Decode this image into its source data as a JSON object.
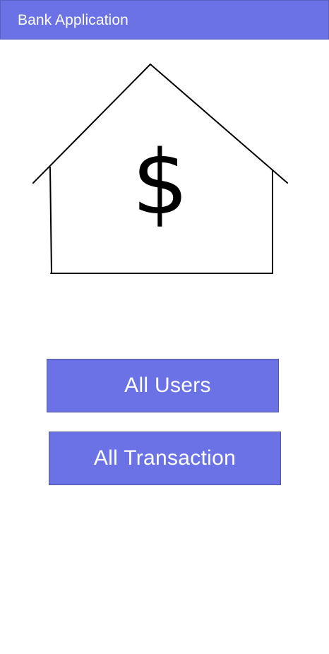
{
  "header": {
    "title": "Bank Application",
    "background_color": "#6b72e6"
  },
  "logo": {
    "icon": "bank-house-dollar-icon",
    "symbol": "$"
  },
  "actions": {
    "all_users_label": "All Users",
    "all_transaction_label": "All Transaction",
    "button_color": "#6b72e6"
  }
}
